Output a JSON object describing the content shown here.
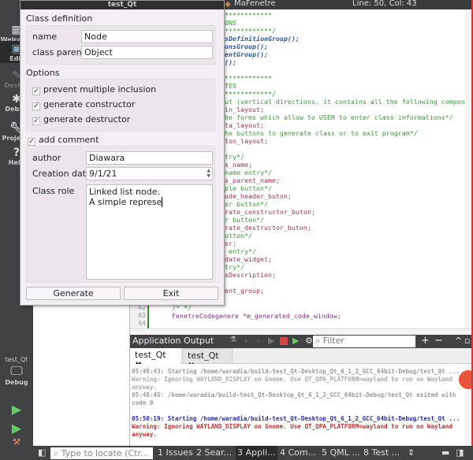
{
  "window": {
    "title": "test_Qt"
  },
  "sidebar": {
    "items": [
      {
        "label": "Welcome",
        "icon": "grid-icon"
      },
      {
        "label": "Edit",
        "icon": "edit-icon",
        "active": true
      },
      {
        "label": "Design",
        "icon": "pencil-icon"
      },
      {
        "label": "Debug",
        "icon": "bug-icon"
      },
      {
        "label": "Projects",
        "icon": "wrench-icon"
      },
      {
        "label": "Help",
        "icon": "help-icon"
      }
    ],
    "kit": {
      "project": "test_Qt",
      "mode": "Debug"
    }
  },
  "editor": {
    "class_selector": "MaFenetre",
    "position": "Line: 50, Col: 43",
    "lines": [
      {
        "c": "g",
        "t": "************"
      },
      {
        "c": "g",
        "t": "ONS"
      },
      {
        "c": "g",
        "t": "************/"
      },
      {
        "c": "b",
        "t": "sDefinitionGroup();"
      },
      {
        "c": "b",
        "t": "onsGroup();"
      },
      {
        "c": "b",
        "t": "entGroup();"
      },
      {
        "c": "b",
        "t": "();"
      },
      {
        "c": "g",
        "t": ""
      },
      {
        "c": "g",
        "t": "************"
      },
      {
        "c": "g",
        "t": "TES"
      },
      {
        "c": "g",
        "t": "************/"
      },
      {
        "c": "g",
        "t": "ut (vertical directions, it contains all the following components)*/"
      },
      {
        "c": "r",
        "t": "in_layout;"
      },
      {
        "c": "g",
        "t": "he forms which allow to USER to enter class informations*/"
      },
      {
        "c": "r",
        "t": "ta_layout;"
      },
      {
        "c": "g",
        "t": "he buttons to generate class or to exit program*/"
      },
      {
        "c": "r",
        "t": "ton_layout;"
      },
      {
        "c": "g",
        "t": ""
      },
      {
        "c": "g",
        "t": "try*/"
      },
      {
        "c": "r",
        "t": "s_name;"
      },
      {
        "c": "g",
        "t": "name entry*/"
      },
      {
        "c": "r",
        "t": "s_parent_name;"
      },
      {
        "c": "g",
        "t": "ple button*/"
      },
      {
        "c": "r",
        "t": "ude_header_buton;"
      },
      {
        "c": "g",
        "t": "or button*/"
      },
      {
        "c": "r",
        "t": "rate_constructor_buton;"
      },
      {
        "c": "g",
        "t": "r button*/"
      },
      {
        "c": "r",
        "t": "rate_destructor_buton;"
      },
      {
        "c": "g",
        "t": "utton*/"
      },
      {
        "c": "r",
        "t": "or;"
      },
      {
        "c": "g",
        "t": " entry*/"
      },
      {
        "c": "r",
        "t": "date_widget;"
      },
      {
        "c": "g",
        "t": "try*/"
      },
      {
        "c": "r",
        "t": "sDescription;"
      },
      {
        "c": "g",
        "t": ""
      },
      {
        "c": "r",
        "t": "ent_group;"
      },
      {
        "c": "g",
        "t": ""
      },
      {
        "c": "g",
        "t": "/* */",
        "n": "62"
      },
      {
        "c": "p",
        "t": "FenetreCodegenere *m_generated_code_window;",
        "n": "63"
      },
      {
        "c": "g",
        "t": "",
        "n": "64"
      }
    ]
  },
  "output": {
    "title": "Application Output",
    "filter_placeholder": "Filter",
    "tabs": [
      "test_Qt",
      "test_Qt"
    ],
    "lines": [
      {
        "c": "#999",
        "t": "05:48:43: Starting /home/waradia/build-test_Qt-Desktop_Qt_6_1_2_GCC_64bit-Debug/test_Qt ..."
      },
      {
        "c": "#aaa",
        "t": "Warning: Ignoring WAYLAND_DISPLAY on Gnome. Use QT_QPA_PLATFORM=wayland to run on Wayland anyway."
      },
      {
        "c": "#999",
        "t": "05:48:45: /home/waradia/build-test_Qt-Desktop_Qt_6_1_2_GCC_64bit-Debug/test_Qt exited with code 0"
      },
      {
        "c": "#fff",
        "t": " "
      },
      {
        "c": "#2a2aa0",
        "t": "05:50:19: Starting /home/waradia/build-test_Qt-Desktop_Qt_6_1_2_GCC_64bit-Debug/test_Qt ..."
      },
      {
        "c": "#c03030",
        "t": "Warning: Ignoring WAYLAND_DISPLAY on Gnome. Use QT_QPA_PLATFORM=wayland to run on Wayland anyway."
      }
    ]
  },
  "statusbar": {
    "locate_placeholder": "Type to locate (Ctr...",
    "tabs": [
      "1 Issues",
      "2 Sear...",
      "3 Appli...",
      "4 Com...",
      "5 QML ...",
      "8 Test ..."
    ]
  },
  "dialog": {
    "class_definition": "Class definition",
    "name_label": "name",
    "name_value": "Node",
    "parent_label": "class parent",
    "parent_value": "Object",
    "options": "Options",
    "opt1": "prevent multiple inclusion",
    "opt2": "generate constructor",
    "opt3": "generate destructor",
    "checked": [
      true,
      true,
      true
    ],
    "add_comment": "add comment",
    "add_comment_checked": true,
    "author_label": "author",
    "author_value": "Diawara",
    "date_label": "Creation date",
    "date_value": "9/1/21",
    "role_label": "Class role",
    "role_line1": "Linked list node.",
    "role_line2": "A simple represe",
    "generate": "Generate",
    "exit": "Exit"
  }
}
